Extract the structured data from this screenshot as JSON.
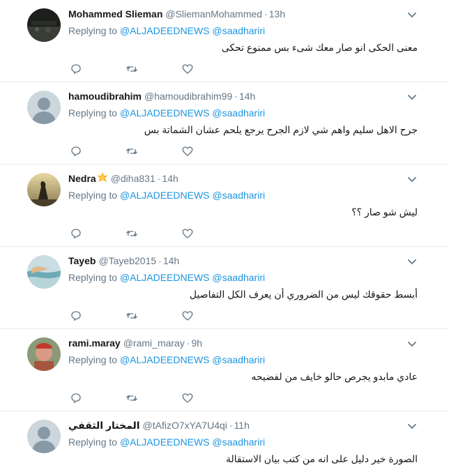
{
  "colors": {
    "link": "#1b95e0",
    "muted": "#657786",
    "text": "#14171a",
    "divider": "#e6ecf0",
    "badge": "#ffad1f"
  },
  "icons": {
    "reply": "reply-icon",
    "retweet": "retweet-icon",
    "like": "heart-icon",
    "more": "chevron-down-icon",
    "badge": "sun-emoji-icon"
  },
  "tweets": [
    {
      "name": "Mohammed Slieman",
      "handle": "@SliemanMohammed",
      "time": "13h",
      "replying_label": "Replying to",
      "mention1": "@ALJADEEDNEWS",
      "mention2": "@saadhariri",
      "text": "معنى الحكى انو صار معك شىء بس ممنوع تحكى",
      "avatar": "dark"
    },
    {
      "name": "hamoudibrahim",
      "handle": "@hamoudibrahim99",
      "time": "14h",
      "replying_label": "Replying to",
      "mention1": "@ALJADEEDNEWS",
      "mention2": "@saadhariri",
      "text": "جرح الاهل سليم واهم شي لازم الجرح يرجع يلحم عشان الشماتة بس",
      "avatar": "default"
    },
    {
      "name": "Nedra",
      "handle": "@diha831",
      "time": "14h",
      "replying_label": "Replying to",
      "mention1": "@ALJADEEDNEWS",
      "mention2": "@saadhariri",
      "text": "ليش شو صار ؟؟",
      "avatar": "sunset",
      "badge": true
    },
    {
      "name": "Tayeb",
      "handle": "@Tayeb2015",
      "time": "14h",
      "replying_label": "Replying to",
      "mention1": "@ALJADEEDNEWS",
      "mention2": "@saadhariri",
      "text": "أبسط حقوقك ليس من الضروري أن يعرف الكل التفاصيل",
      "avatar": "sea"
    },
    {
      "name": "rami.maray",
      "handle": "@rami_maray",
      "time": "9h",
      "replying_label": "Replying to",
      "mention1": "@ALJADEEDNEWS",
      "mention2": "@saadhariri",
      "text": "عادي مابدو يجرص حالو خايف من لفضيحه",
      "avatar": "photo"
    },
    {
      "name": "المختار الثقفي",
      "handle": "@tAfizO7xYA7U4qi",
      "time": "11h",
      "replying_label": "Replying to",
      "mention1": "@ALJADEEDNEWS",
      "mention2": "@saadhariri",
      "text": "الصورة خير دليل على انه من كتب بيان الاستقالة",
      "avatar": "default"
    }
  ]
}
